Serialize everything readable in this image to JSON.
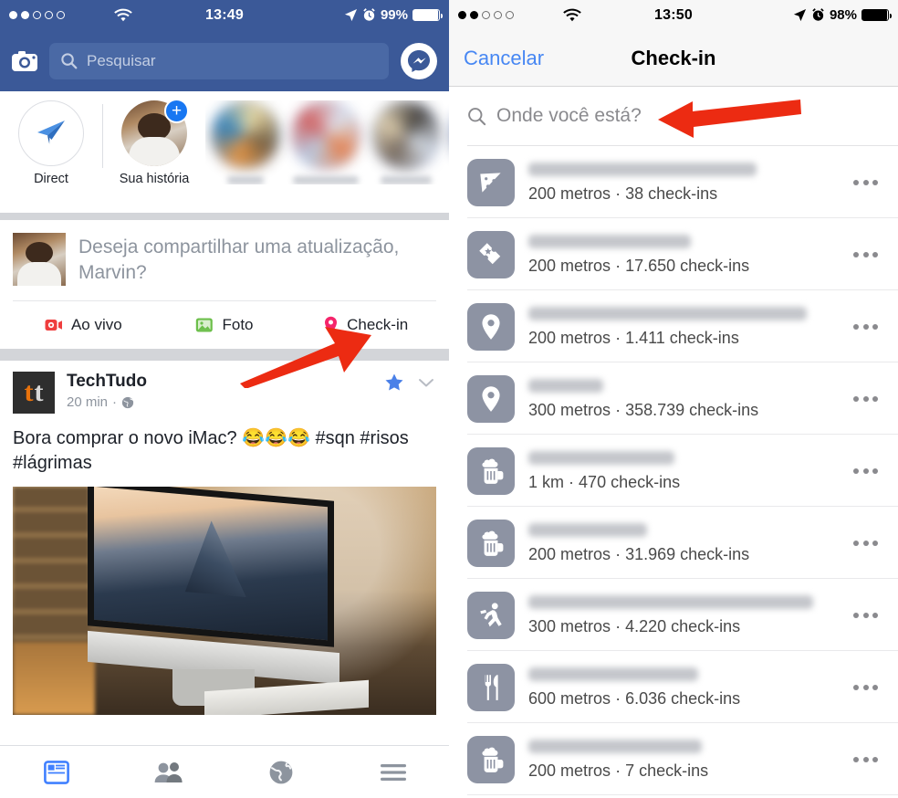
{
  "left_screen": {
    "status_bar": {
      "carrier_signal_filled": 2,
      "carrier_signal_total": 5,
      "wifi_icon": "wifi-icon",
      "time": "13:49",
      "location_icon": "location-arrow-icon",
      "alarm_icon": "alarm-clock-icon",
      "battery_percent": "99%"
    },
    "nav": {
      "camera_icon": "camera-icon",
      "search_placeholder": "Pesquisar",
      "search_icon": "search-icon",
      "messenger_icon": "messenger-icon"
    },
    "stories": {
      "direct_label": "Direct",
      "direct_icon": "paper-plane-icon",
      "your_story_label": "Sua história",
      "add_story_badge": "+",
      "blurred_stories": 3
    },
    "composer": {
      "prompt": "Deseja compartilhar uma atualização, Marvin?",
      "actions": [
        {
          "label": "Ao vivo",
          "icon": "live-video-icon",
          "color": "#ef3e3e"
        },
        {
          "label": "Foto",
          "icon": "photo-icon",
          "color": "#6cbf4b"
        },
        {
          "label": "Check-in",
          "icon": "location-pin-icon",
          "color": "#f5256b"
        }
      ]
    },
    "post": {
      "logo_left": "t",
      "logo_right": "t",
      "author": "TechTudo",
      "time": "20 min",
      "separator": "·",
      "privacy_icon": "globe-icon",
      "star_icon": "star-icon",
      "chevron_icon": "chevron-down-icon",
      "text": "Bora comprar o novo iMac? 😂😂😂 #sqn #risos #lágrimas",
      "image_alt": "imac-photo"
    },
    "tabbar": [
      {
        "name": "news-feed",
        "icon": "news-feed-icon",
        "active": true
      },
      {
        "name": "friend-requests",
        "icon": "friends-icon",
        "active": false
      },
      {
        "name": "notifications",
        "icon": "globe-icon",
        "active": false
      },
      {
        "name": "more-menu",
        "icon": "hamburger-icon",
        "active": false
      }
    ]
  },
  "right_screen": {
    "status_bar": {
      "carrier_signal_filled": 2,
      "carrier_signal_total": 5,
      "wifi_icon": "wifi-icon",
      "time": "13:50",
      "location_icon": "location-arrow-icon",
      "alarm_icon": "alarm-clock-icon",
      "battery_percent": "98%"
    },
    "nav": {
      "cancel_label": "Cancelar",
      "title": "Check-in"
    },
    "search": {
      "icon": "search-icon",
      "placeholder": "Onde você está?"
    },
    "places": [
      {
        "icon": "pizza-icon",
        "name_blurred": true,
        "distance": "200 metros",
        "separator": "·",
        "checkins": "38 check-ins",
        "more_icon": "more-options-icon",
        "name_width": 250
      },
      {
        "icon": "ticket-icon",
        "name_blurred": true,
        "distance": "200 metros",
        "separator": "·",
        "checkins": "17.650 check-ins",
        "more_icon": "more-options-icon",
        "name_width": 178
      },
      {
        "icon": "pin-icon",
        "name_blurred": true,
        "distance": "200 metros",
        "separator": "·",
        "checkins": "1.411 check-ins",
        "more_icon": "more-options-icon",
        "name_width": 305
      },
      {
        "icon": "pin-icon",
        "name_blurred": true,
        "distance": "300 metros",
        "separator": "·",
        "checkins": "358.739 check-ins",
        "more_icon": "more-options-icon",
        "name_width": 82
      },
      {
        "icon": "beer-icon",
        "name_blurred": true,
        "distance": "1 km",
        "separator": "·",
        "checkins": "470 check-ins",
        "more_icon": "more-options-icon",
        "name_width": 160
      },
      {
        "icon": "beer-icon",
        "name_blurred": true,
        "distance": "200 metros",
        "separator": "·",
        "checkins": "31.969 check-ins",
        "more_icon": "more-options-icon",
        "name_width": 130
      },
      {
        "icon": "running-icon",
        "name_blurred": true,
        "distance": "300 metros",
        "separator": "·",
        "checkins": "4.220 check-ins",
        "more_icon": "more-options-icon",
        "name_width": 312
      },
      {
        "icon": "cutlery-icon",
        "name_blurred": true,
        "distance": "600 metros",
        "separator": "·",
        "checkins": "6.036 check-ins",
        "more_icon": "more-options-icon",
        "name_width": 186
      },
      {
        "icon": "beer-icon",
        "name_blurred": true,
        "distance": "200 metros",
        "separator": "·",
        "checkins": "7 check-ins",
        "more_icon": "more-options-icon",
        "name_width": 190
      }
    ]
  },
  "annotations": {
    "arrow_color": "#ec2b12",
    "arrows": [
      {
        "name": "arrow-to-checkin-button",
        "target": "Check-in"
      },
      {
        "name": "arrow-to-search-field",
        "target": "Onde você está?"
      }
    ]
  }
}
